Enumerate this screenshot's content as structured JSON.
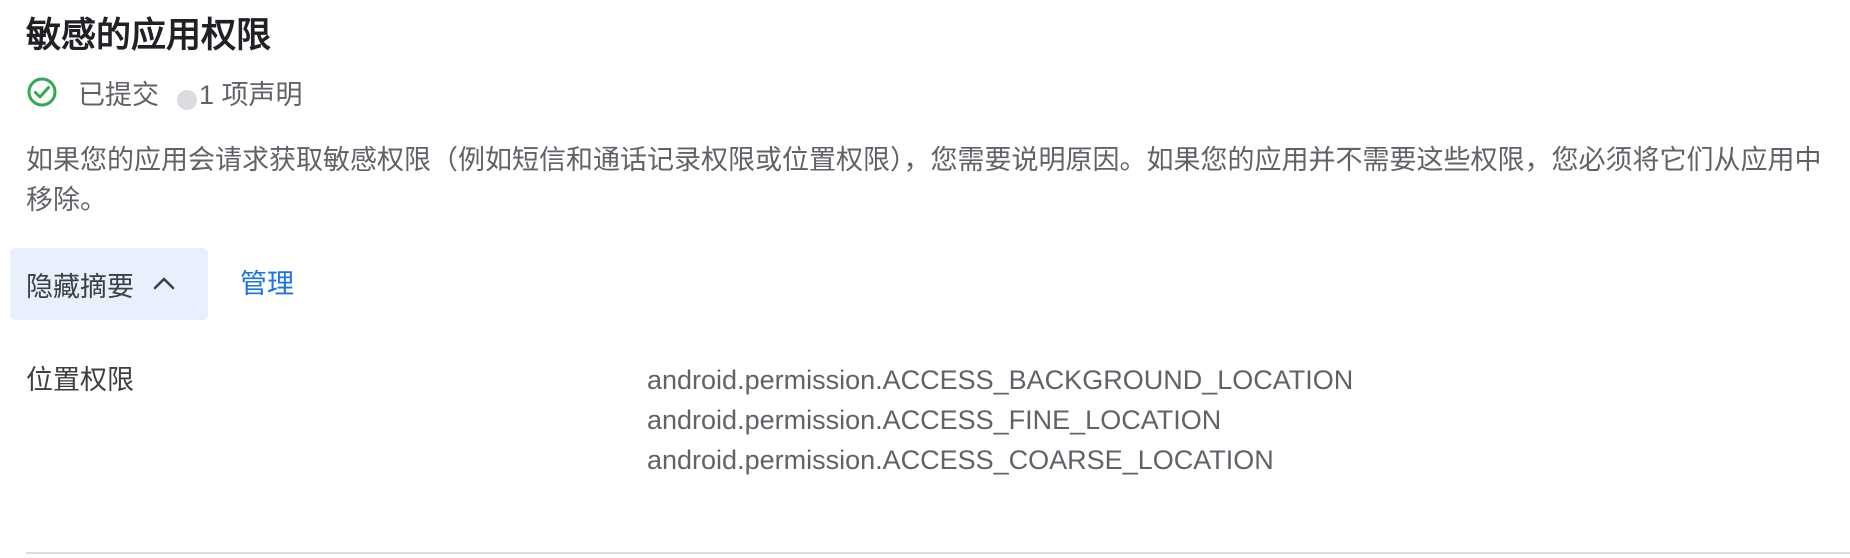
{
  "section": {
    "title": "敏感的应用权限",
    "status": {
      "submitted_label": "已提交",
      "declaration_count_label": "1 项声明",
      "check_color": "#34a853"
    },
    "description": "如果您的应用会请求获取敏感权限（例如短信和通话记录权限或位置权限），您需要说明原因。如果您的应用并不需要这些权限，您必须将它们从应用中移除。",
    "actions": {
      "toggle_summary_label": "隐藏摘要",
      "toggle_icon": "chevron-up-icon",
      "manage_label": "管理"
    },
    "permission_group": {
      "label": "位置权限",
      "permissions": [
        "android.permission.ACCESS_BACKGROUND_LOCATION",
        "android.permission.ACCESS_FINE_LOCATION",
        "android.permission.ACCESS_COARSE_LOCATION"
      ]
    }
  }
}
